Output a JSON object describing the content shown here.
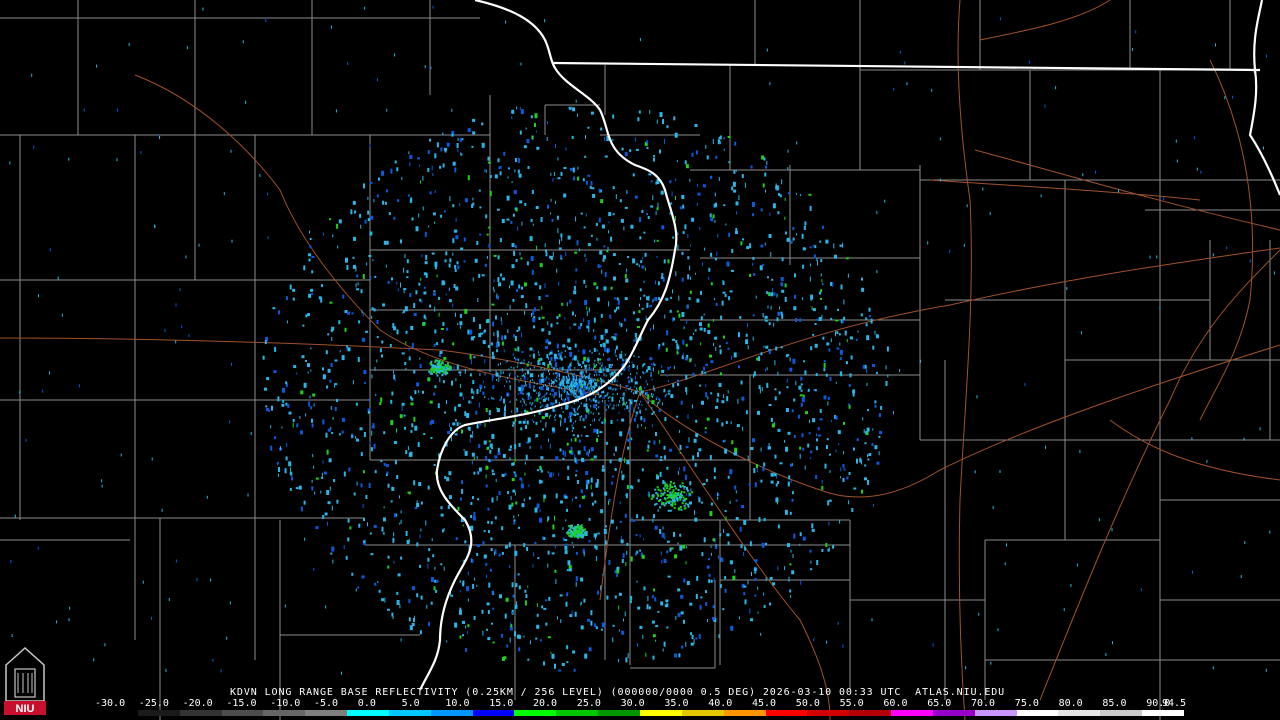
{
  "product": {
    "caption": "KDVN LONG RANGE BASE REFLECTIVITY (0.25KM / 256 LEVEL) (000000/0000 0.5 DEG) 2026-03-10 00:33 UTC  ATLAS.NIU.EDU"
  },
  "logo": {
    "text": "NIU"
  },
  "colorscale": {
    "labels": [
      "-30.0",
      "-25.0",
      "-20.0",
      "-15.0",
      "-10.0",
      "-5.0",
      "0.0",
      "5.0",
      "10.0",
      "15.0",
      "20.0",
      "25.0",
      "30.0",
      "35.0",
      "40.0",
      "45.0",
      "50.0",
      "55.0",
      "60.0",
      "65.0",
      "70.0",
      "75.0",
      "80.0",
      "85.0",
      "90.0",
      "94.5"
    ],
    "colors": [
      "#000000",
      "#1a1a1a",
      "#333333",
      "#4d4d4d",
      "#666666",
      "#7f7f7f",
      "#00ffff",
      "#00c8ff",
      "#0096ff",
      "#0000ff",
      "#00ff00",
      "#00c800",
      "#009600",
      "#ffff00",
      "#e6c800",
      "#ff9600",
      "#ff0000",
      "#d20000",
      "#b40000",
      "#ff00ff",
      "#9600c8",
      "#c896ff",
      "#ffffff",
      "#e6e6e6",
      "#cccccc",
      "#ffffff"
    ]
  },
  "map_colors": {
    "background": "#000000",
    "county_lines": "#8c8c8c",
    "state_lines": "#ffffff",
    "highways": "#a0522d",
    "echo_light": "#2ab6e6",
    "echo_mid": "#0a5adc",
    "echo_strong": "#1ed21e"
  }
}
